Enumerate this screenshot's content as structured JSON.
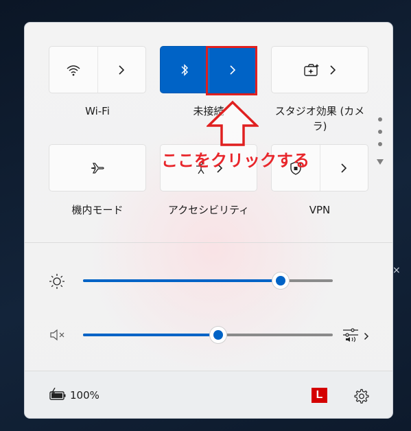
{
  "tiles": {
    "wifi": {
      "label": "Wi-Fi",
      "icon": "wifi-icon",
      "expand_icon": "chevron-right-icon"
    },
    "bluetooth": {
      "label": "未接続",
      "icon": "bluetooth-icon",
      "expand_icon": "chevron-right-icon",
      "active": true
    },
    "studio_effects": {
      "label": "スタジオ効果 (カメラ)",
      "icon": "camera-effects-icon",
      "expand_icon": "chevron-right-icon"
    },
    "airplane": {
      "label": "機内モード",
      "icon": "airplane-icon"
    },
    "accessibility": {
      "label": "アクセシビリティ",
      "icon": "accessibility-icon",
      "expand_icon": "chevron-right-icon"
    },
    "vpn": {
      "label": "VPN",
      "icon": "shield-icon",
      "expand_icon": "chevron-right-icon"
    }
  },
  "annotation": {
    "text": "ここをクリックする",
    "color": "#e02020"
  },
  "sliders": {
    "brightness": {
      "icon": "brightness-icon",
      "value_fraction": 0.79
    },
    "volume": {
      "icon": "speaker-muted-icon",
      "value_fraction": 0.54,
      "output_icon": "audio-output-icon"
    }
  },
  "footer": {
    "battery_icon": "battery-charging-icon",
    "battery_text": "100%",
    "badge_text": "L",
    "settings_icon": "gear-icon"
  },
  "colors": {
    "accent": "#0063c6",
    "annotation": "#e02020"
  }
}
